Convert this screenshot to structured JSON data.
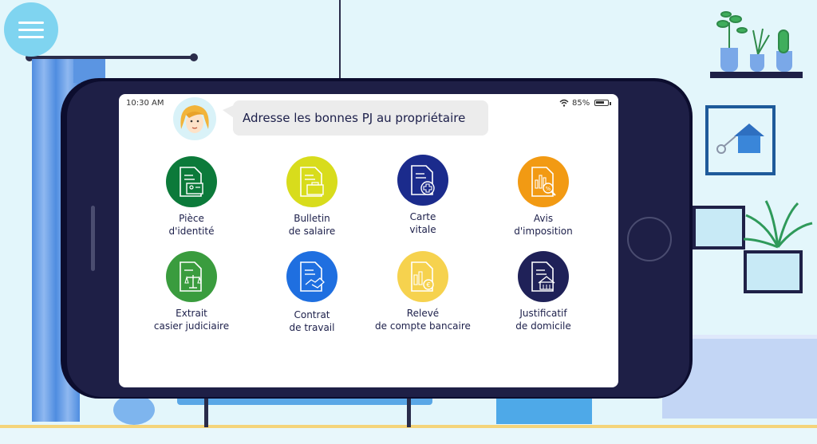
{
  "status_bar": {
    "time": "10:30 AM",
    "battery": "85%"
  },
  "prompt": {
    "text": "Adresse les bonnes PJ au propriétaire"
  },
  "colors": {
    "identite": "#0c7a3a",
    "salaire": "#d8dc1c",
    "vitale": "#1b2b8c",
    "imposition": "#f29a13",
    "casier": "#3a9c3e",
    "travail": "#1f6fe0",
    "bancaire": "#f6d24e",
    "domicile": "#1f2158"
  },
  "documents": [
    {
      "line1": "Pièce",
      "line2": "d'identité",
      "icon": "id-card-icon"
    },
    {
      "line1": "Bulletin",
      "line2": "de salaire",
      "icon": "briefcase-document-icon"
    },
    {
      "line1": "Carte",
      "line2": "vitale",
      "icon": "health-cross-icon"
    },
    {
      "line1": "Avis",
      "line2": "d'imposition",
      "icon": "tax-percent-icon"
    },
    {
      "line1": "Extrait",
      "line2": "casier judiciaire",
      "icon": "justice-scale-icon"
    },
    {
      "line1": "Contrat",
      "line2": "de travail",
      "icon": "handshake-icon"
    },
    {
      "line1": "Relevé",
      "line2": "de compte bancaire",
      "icon": "bank-euro-icon"
    },
    {
      "line1": "Justificatif",
      "line2": "de domicile",
      "icon": "house-document-icon"
    }
  ]
}
